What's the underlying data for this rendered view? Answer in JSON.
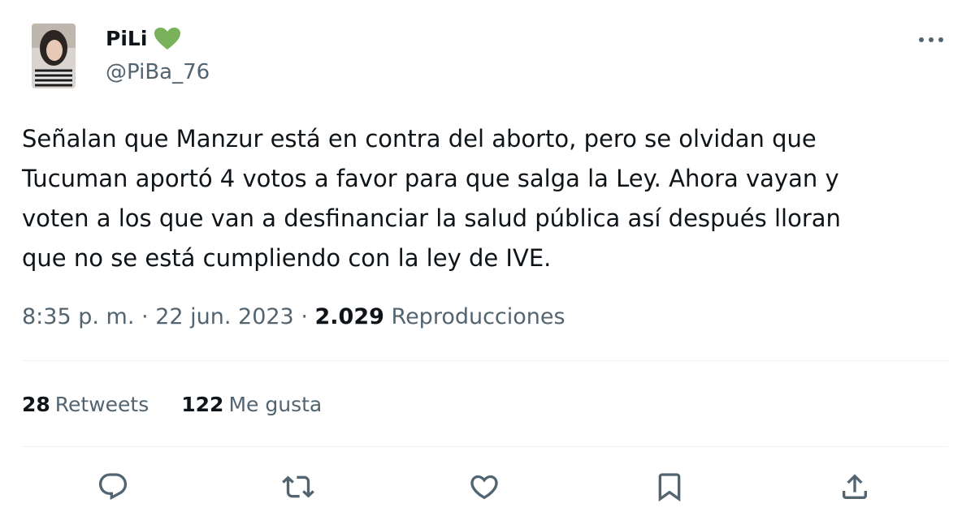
{
  "author": {
    "display_name": "PiLi",
    "handle": "@PiBa_76",
    "name_emoji_icon": "green-heart-icon",
    "avatar_icon": "avatar"
  },
  "tweet": {
    "text": "Señalan que Manzur está en contra del aborto, pero se olvidan que\nTucuman aportó 4 votos a favor para que salga la Ley. Ahora vayan y\nvoten a los que van a desfinanciar la salud pública así después lloran\nque no se está cumpliendo con la ley de IVE.",
    "time": "8:35 p. m.",
    "separator": "·",
    "date": "22 jun. 2023",
    "views_count": "2.029",
    "views_label": "Reproducciones"
  },
  "stats": {
    "retweets_count": "28",
    "retweets_label": "Retweets",
    "likes_count": "122",
    "likes_label": "Me gusta"
  },
  "actions": [
    {
      "name": "reply",
      "icon": "reply-icon"
    },
    {
      "name": "retweet",
      "icon": "retweet-icon"
    },
    {
      "name": "like",
      "icon": "heart-icon"
    },
    {
      "name": "bookmark",
      "icon": "bookmark-icon"
    },
    {
      "name": "share",
      "icon": "share-icon"
    }
  ],
  "colors": {
    "text_primary": "#0f1419",
    "text_secondary": "#536471",
    "divider": "#eff3f4",
    "heart_green": "#78b159"
  }
}
